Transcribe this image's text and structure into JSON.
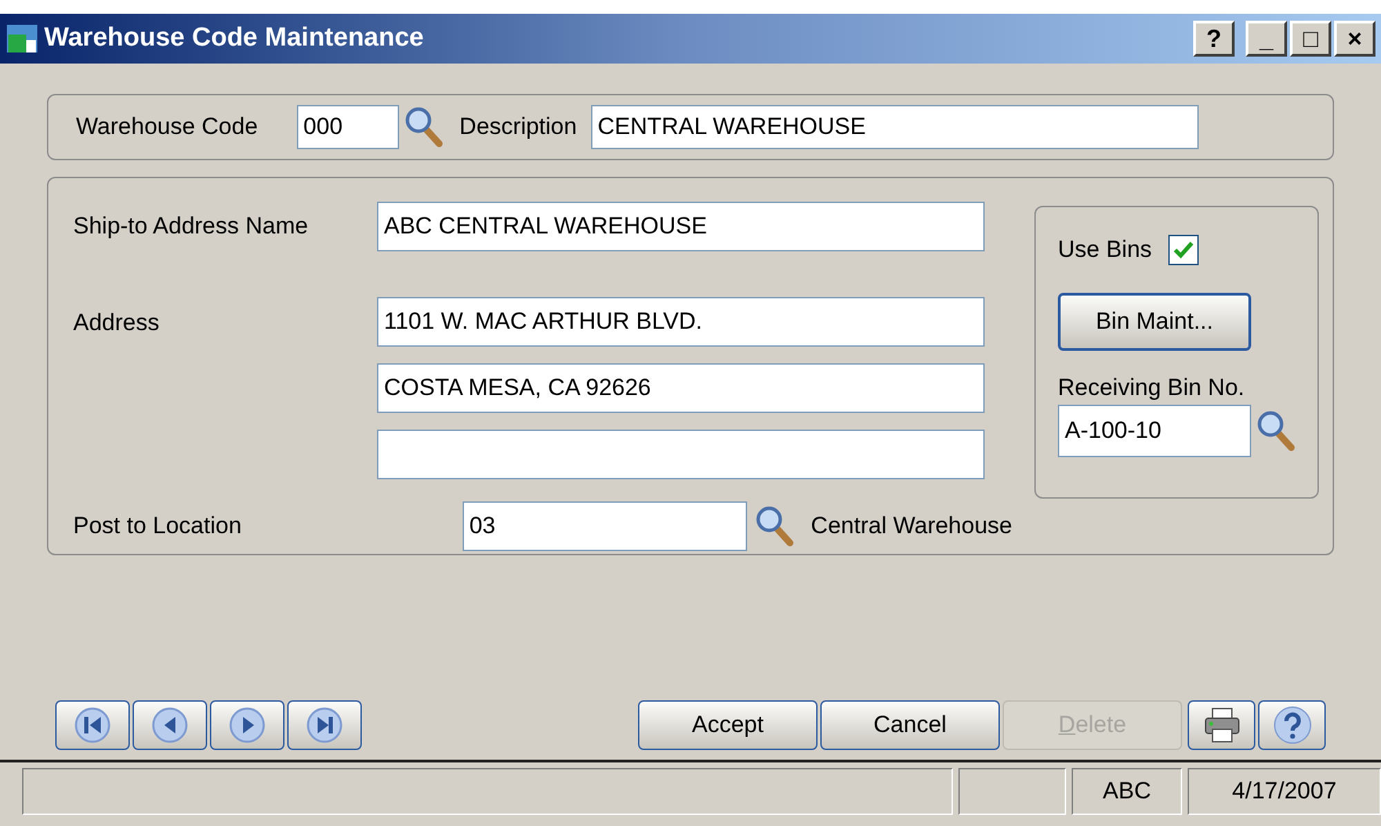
{
  "window": {
    "title": "Warehouse Code Maintenance",
    "controls": [
      "?",
      "_",
      "□",
      "×"
    ]
  },
  "header": {
    "code_label": "Warehouse Code",
    "code_value": "000",
    "description_label": "Description",
    "description_value": "CENTRAL WAREHOUSE"
  },
  "address": {
    "name_label": "Ship-to Address Name",
    "name_value": "ABC CENTRAL WAREHOUSE",
    "address_label": "Address",
    "lines": [
      "1101 W. MAC ARTHUR BLVD.",
      "COSTA MESA, CA 92626"
    ],
    "location_label": "Post to Location",
    "location_value": "03",
    "location_name": "Central Warehouse"
  },
  "bins": {
    "use_label": "Use Bins",
    "use_checked": true,
    "maint_button": "Bin Maint...",
    "receiving_label": "Receiving Bin No.",
    "receiving_value": "A-100-10"
  },
  "nav_buttons": [
    {
      "kind": "first"
    },
    {
      "kind": "previous"
    },
    {
      "kind": "next"
    },
    {
      "kind": "last"
    }
  ],
  "actions": [
    {
      "label": "Accept",
      "disabled": false
    },
    {
      "label": "Cancel",
      "disabled": false
    },
    {
      "label": "Delete",
      "disabled": true
    }
  ],
  "status_bar": [
    "ABC",
    "4/17/2007"
  ]
}
